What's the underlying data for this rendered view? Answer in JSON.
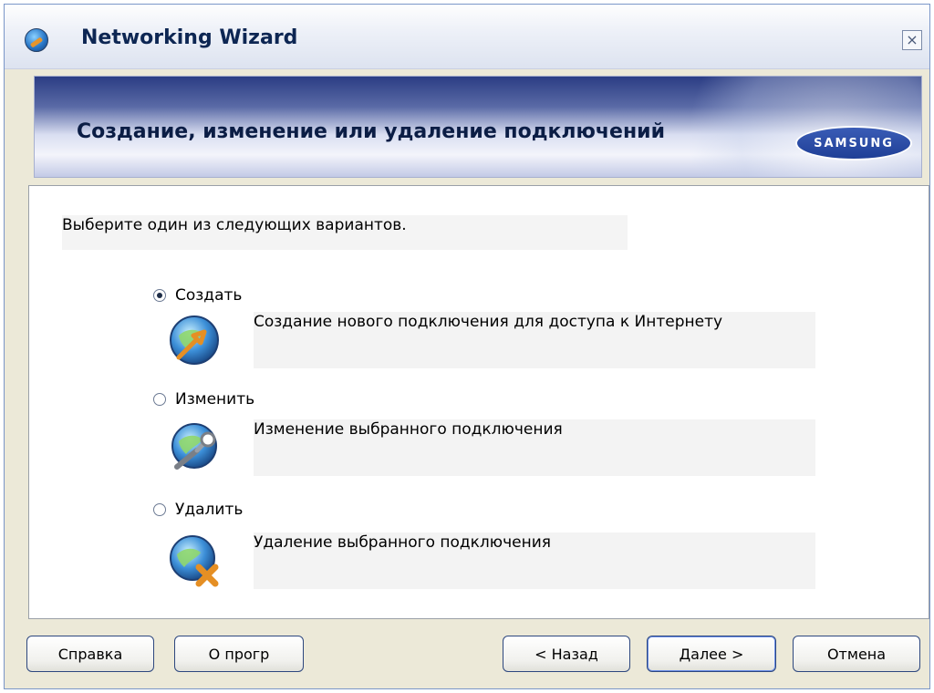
{
  "window": {
    "title": "Networking Wizard",
    "close_symbol": "×"
  },
  "banner": {
    "title": "Создание, изменение или удаление подключений",
    "brand": "SAMSUNG"
  },
  "prompt": "Выберите один из следующих вариантов.",
  "options": [
    {
      "label": "Создать",
      "description": "Создание нового подключения для доступа к Интернету",
      "icon": "globe-arrow-icon",
      "selected": true
    },
    {
      "label": "Изменить",
      "description": "Изменение выбранного подключения",
      "icon": "globe-wrench-icon",
      "selected": false
    },
    {
      "label": "Удалить",
      "description": "Удаление выбранного подключения",
      "icon": "globe-delete-icon",
      "selected": false
    }
  ],
  "buttons": {
    "help": "Справка",
    "about": "О прогр",
    "back": "< Назад",
    "next": "Далее >",
    "cancel": "Отмена"
  }
}
